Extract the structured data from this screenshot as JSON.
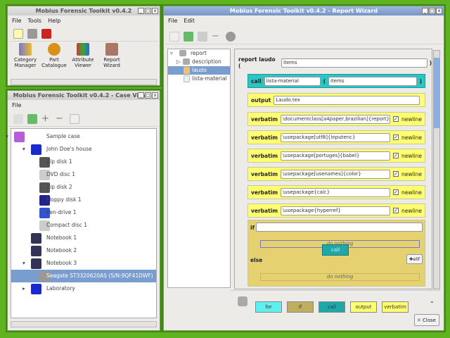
{
  "main_window": {
    "title": "Mobius Forensic Toolkit v0.4.2",
    "menu": [
      "File",
      "Tools",
      "Help"
    ],
    "launchers": [
      {
        "line1": "Category",
        "line2": "Manager",
        "icon": "category-manager-icon"
      },
      {
        "line1": "Part",
        "line2": "Catalogue",
        "icon": "gears-icon"
      },
      {
        "line1": "Attribute",
        "line2": "Viewer",
        "icon": "cubes-icon"
      },
      {
        "line1": "Report",
        "line2": "Wizard",
        "icon": "wizard-icon"
      }
    ]
  },
  "case_viewer": {
    "title": "Mobius Forensic Toolkit v0.4.2 - Case Viewer",
    "menu": [
      "File"
    ],
    "tree": [
      "Sample case",
      "John Doe's house",
      "Zip disk 1",
      "DVD disc 1",
      "Zip disk 2",
      "Floppy disk 1",
      "Pen-drive 1",
      "Compact disc 1",
      "Notebook 1",
      "Notebook 2",
      "Notebook 3",
      "Seagate ST3320620AS (S/N:9QF41DWF)",
      "Laboratory"
    ],
    "selected": "Seagate ST3320620AS (S/N:9QF41DWF)"
  },
  "report_wizard": {
    "title": "Mobius Forensic Toolkit v0.4.2 - Report Wizard",
    "menu": [
      "File",
      "Edit"
    ],
    "tree": [
      "report",
      "description",
      "laudo",
      "lista-material"
    ],
    "report_kw": "report laudo (",
    "report_args": "items",
    "paren_close": ")",
    "call": {
      "kw": "call",
      "name": "lista-material",
      "paren": "(",
      "args": "items",
      "close": ")"
    },
    "output": {
      "kw": "output",
      "value": "Laudo.tex"
    },
    "verbatim_kw": "verbatim",
    "newline_label": "newline",
    "check": "✓",
    "verbatims": [
      "\\documentclass[a4paper,brazilian]{report}",
      "\\usepackage[utf8]{inputenc}",
      "\\usepackage[portuges]{babel}",
      "\\usepackage[usenames]{color}",
      "\\usepackage{calc}",
      "\\usepackage{hyperref}"
    ],
    "if_kw": "if",
    "else_kw": "else",
    "do_nothing": "do nothing",
    "drag_label": "call",
    "elif_label": "elif",
    "palette": [
      "for",
      "if",
      "call",
      "output",
      "verbatim"
    ],
    "close_label": "Close"
  },
  "colors": {
    "desktop": "#5fb320",
    "call": "#2ec4c4",
    "yellow": "#ffff70",
    "if": "#e6d170",
    "selection": "#7a9dd0"
  }
}
